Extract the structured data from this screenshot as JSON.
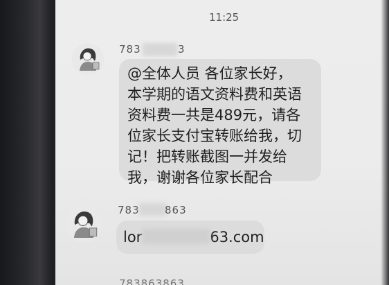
{
  "status_bar": {
    "time": "11:25"
  },
  "messages": [
    {
      "sender_visible_prefix": "783",
      "sender_visible_suffix": "3",
      "avatar_icon": "cartoon-woman-avatar-icon",
      "lines": [
        "@全体人员 各位家长好，",
        "本学期的语文资料费和英语",
        "资料费一共是489元，请各",
        "位家长支付宝转账给我，切",
        "记！把转账截图一并发给",
        "我，谢谢各位家长配合"
      ]
    },
    {
      "sender_visible_prefix": "783",
      "sender_visible_suffix": "863",
      "avatar_icon": "cartoon-woman-avatar-icon",
      "email_visible_prefix": "lor",
      "email_visible_suffix": "63.com"
    },
    {
      "sender_partial": "783863863"
    }
  ],
  "colors": {
    "screen_bg": "#ececec",
    "bubble_bg": "#dcdcdc",
    "text": "#1f1f1f",
    "meta_text": "#555555",
    "phone_frame": "#1f2024"
  }
}
